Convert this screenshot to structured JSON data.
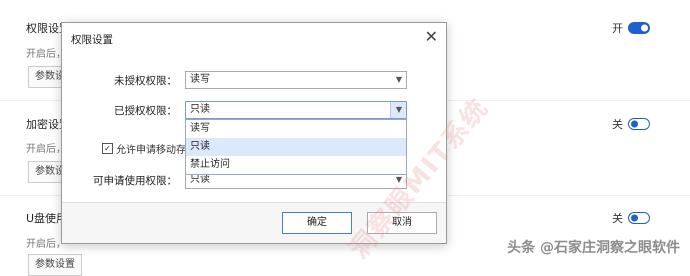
{
  "background": {
    "sections": [
      {
        "title": "权限设置",
        "desc": "开启后，",
        "button": "参数设置",
        "toggle_label": "开",
        "toggle_on": true
      },
      {
        "title": "加密设置",
        "desc": "开启后，",
        "button": "参数设置",
        "toggle_label": "关",
        "toggle_on": false
      },
      {
        "title": "U盘使用",
        "desc": "开启后，",
        "button": "参数设置",
        "toggle_label": "关",
        "toggle_on": false
      }
    ]
  },
  "dialog": {
    "title": "权限设置",
    "fields": {
      "unauthorized_label": "未授权权限：",
      "unauthorized_value": "读写",
      "authorized_label": "已授权权限：",
      "authorized_value": "只读",
      "applicable_label": "可申请使用权限：",
      "applicable_value": "只读"
    },
    "dropdown_options": [
      "读写",
      "只读",
      "禁止访问"
    ],
    "dropdown_selected": "只读",
    "checkbox_label": "允许申请移动存储",
    "checkbox_checked": true,
    "ok_label": "确定",
    "cancel_label": "取消"
  },
  "watermarks": {
    "diagonal": "洞察眼MIT系统",
    "corner": "头条 @石家庄洞察之眼软件"
  },
  "colors": {
    "accent": "#1f5fcf",
    "dropdown_highlight": "#dce8fb"
  }
}
